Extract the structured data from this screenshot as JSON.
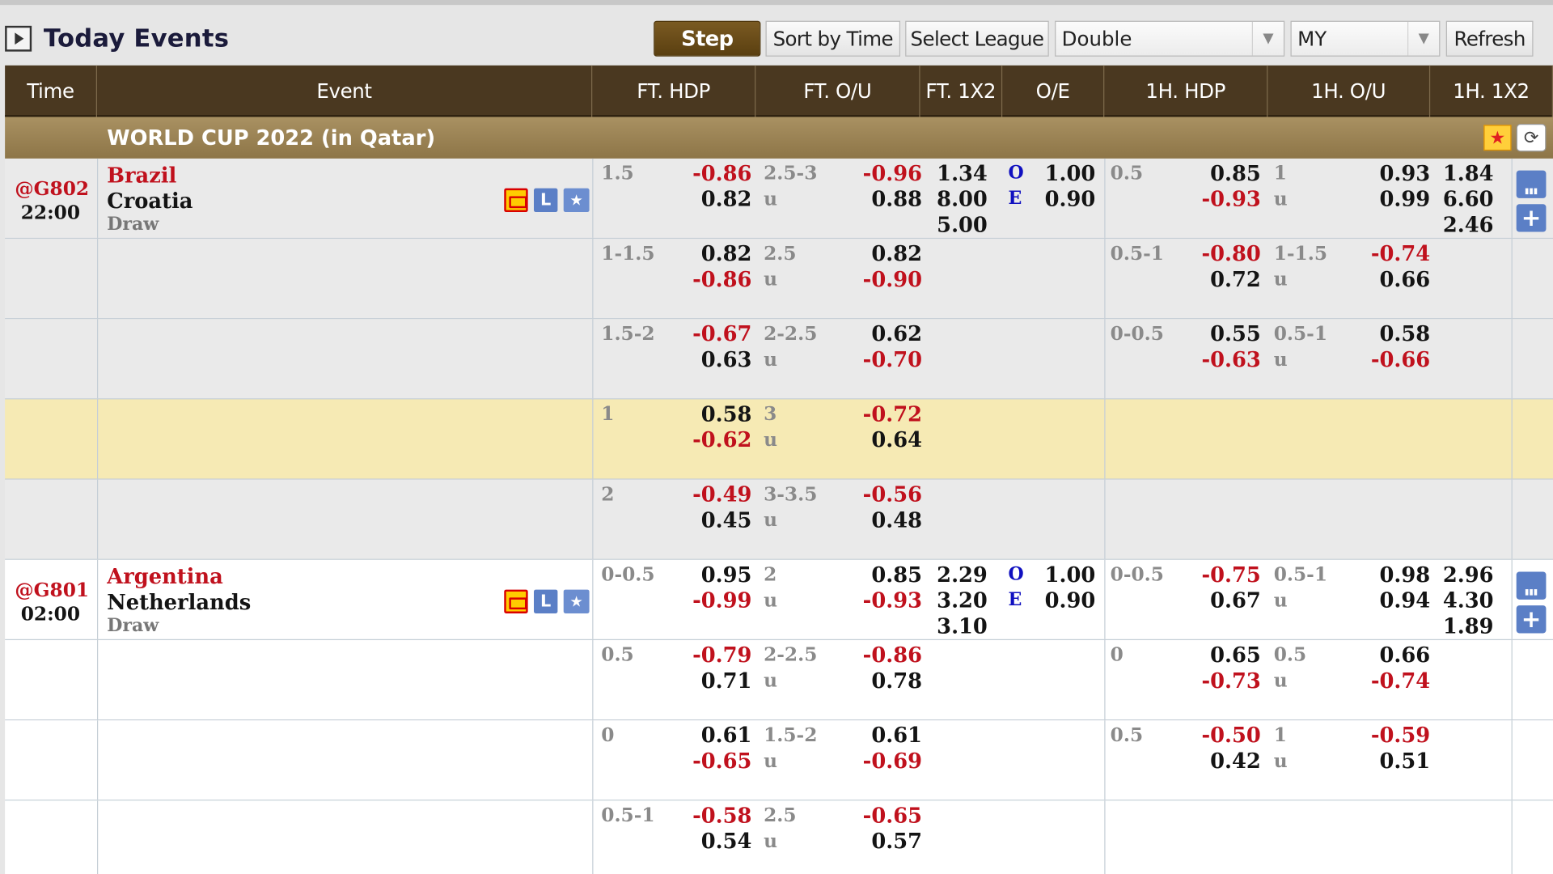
{
  "toolbar": {
    "title": "Today Events",
    "step_label": "Step",
    "sort_label": "Sort by Time",
    "league_label": "Select League",
    "double_value": "Double",
    "my_value": "MY",
    "refresh_label": "Refresh"
  },
  "headers": [
    "Time",
    "Event",
    "FT. HDP",
    "FT. O/U",
    "FT. 1X2",
    "O/E",
    "1H. HDP",
    "1H. O/U",
    "1H. 1X2"
  ],
  "league": {
    "name": "WORLD CUP 2022 (in Qatar)"
  },
  "matches": [
    {
      "code": "@G802",
      "time": "22:00",
      "home": "Brazil",
      "away": "Croatia",
      "draw": "Draw",
      "rows": [
        {
          "ft_hdp": {
            "line": "1.5",
            "top": "-0.86",
            "bot": "0.82"
          },
          "ft_ou": {
            "line": "2.5-3",
            "u": "u",
            "top": "-0.96",
            "bot": "0.88"
          },
          "ft_1x2": [
            "1.34",
            "8.00",
            "5.00"
          ],
          "oe": {
            "o": "O",
            "e": "E",
            "ov": "1.00",
            "ev": "0.90"
          },
          "h_hdp": {
            "line": "0.5",
            "top": "0.85",
            "bot": "-0.93"
          },
          "h_ou": {
            "line": "1",
            "u": "u",
            "top": "0.93",
            "bot": "0.99"
          },
          "h_1x2": [
            "1.84",
            "6.60",
            "2.46"
          ]
        },
        {
          "ft_hdp": {
            "line": "1-1.5",
            "top": "0.82",
            "bot": "-0.86"
          },
          "ft_ou": {
            "line": "2.5",
            "u": "u",
            "top": "0.82",
            "bot": "-0.90"
          },
          "h_hdp": {
            "line": "0.5-1",
            "top": "-0.80",
            "bot": "0.72"
          },
          "h_ou": {
            "line": "1-1.5",
            "u": "u",
            "top": "-0.74",
            "bot": "0.66"
          }
        },
        {
          "ft_hdp": {
            "line": "1.5-2",
            "top": "-0.67",
            "bot": "0.63"
          },
          "ft_ou": {
            "line": "2-2.5",
            "u": "u",
            "top": "0.62",
            "bot": "-0.70"
          },
          "h_hdp": {
            "line": "0-0.5",
            "top": "0.55",
            "bot": "-0.63"
          },
          "h_ou": {
            "line": "0.5-1",
            "u": "u",
            "top": "0.58",
            "bot": "-0.66"
          }
        },
        {
          "ft_hdp": {
            "line": "1",
            "top": "0.58",
            "bot": "-0.62"
          },
          "ft_ou": {
            "line": "3",
            "u": "u",
            "top": "-0.72",
            "bot": "0.64"
          }
        },
        {
          "ft_hdp": {
            "line": "2",
            "top": "-0.49",
            "bot": "0.45"
          },
          "ft_ou": {
            "line": "3-3.5",
            "u": "u",
            "top": "-0.56",
            "bot": "0.48"
          }
        }
      ]
    },
    {
      "code": "@G801",
      "time": "02:00",
      "home": "Argentina",
      "away": "Netherlands",
      "draw": "Draw",
      "rows": [
        {
          "ft_hdp": {
            "line": "0-0.5",
            "top": "0.95",
            "bot": "-0.99"
          },
          "ft_ou": {
            "line": "2",
            "u": "u",
            "top": "0.85",
            "bot": "-0.93"
          },
          "ft_1x2": [
            "2.29",
            "3.20",
            "3.10"
          ],
          "oe": {
            "o": "O",
            "e": "E",
            "ov": "1.00",
            "ev": "0.90"
          },
          "h_hdp": {
            "line": "0-0.5",
            "top": "-0.75",
            "bot": "0.67"
          },
          "h_ou": {
            "line": "0.5-1",
            "u": "u",
            "top": "0.98",
            "bot": "0.94"
          },
          "h_1x2": [
            "2.96",
            "4.30",
            "1.89"
          ]
        },
        {
          "ft_hdp": {
            "line": "0.5",
            "top": "-0.79",
            "bot": "0.71"
          },
          "ft_ou": {
            "line": "2-2.5",
            "u": "u",
            "top": "-0.86",
            "bot": "0.78"
          },
          "h_hdp": {
            "line": "0",
            "top": "0.65",
            "bot": "-0.73"
          },
          "h_ou": {
            "line": "0.5",
            "u": "u",
            "top": "0.66",
            "bot": "-0.74"
          }
        },
        {
          "ft_hdp": {
            "line": "0",
            "top": "0.61",
            "bot": "-0.65"
          },
          "ft_ou": {
            "line": "1.5-2",
            "u": "u",
            "top": "0.61",
            "bot": "-0.69"
          },
          "h_hdp": {
            "line": "0.5",
            "top": "-0.50",
            "bot": "0.42"
          },
          "h_ou": {
            "line": "1",
            "u": "u",
            "top": "-0.59",
            "bot": "0.51"
          }
        },
        {
          "ft_hdp": {
            "line": "0.5-1",
            "top": "-0.58",
            "bot": "0.54"
          },
          "ft_ou": {
            "line": "2.5",
            "u": "u",
            "top": "-0.65",
            "bot": "0.57"
          }
        }
      ]
    }
  ],
  "colors": {
    "header_bg": "#4a3820",
    "league_bg": "#9c8455",
    "odds_negative": "#c0111d",
    "odds_positive": "#141414",
    "highlight_row": "#f6eab4"
  },
  "icons": {
    "expand": "play-square-icon",
    "live_tv": "tv-icon",
    "live": "l-icon",
    "favorite": "star-icon",
    "stats": "bar-chart-icon",
    "more": "plus-icon",
    "refresh_league": "reload-icon"
  }
}
